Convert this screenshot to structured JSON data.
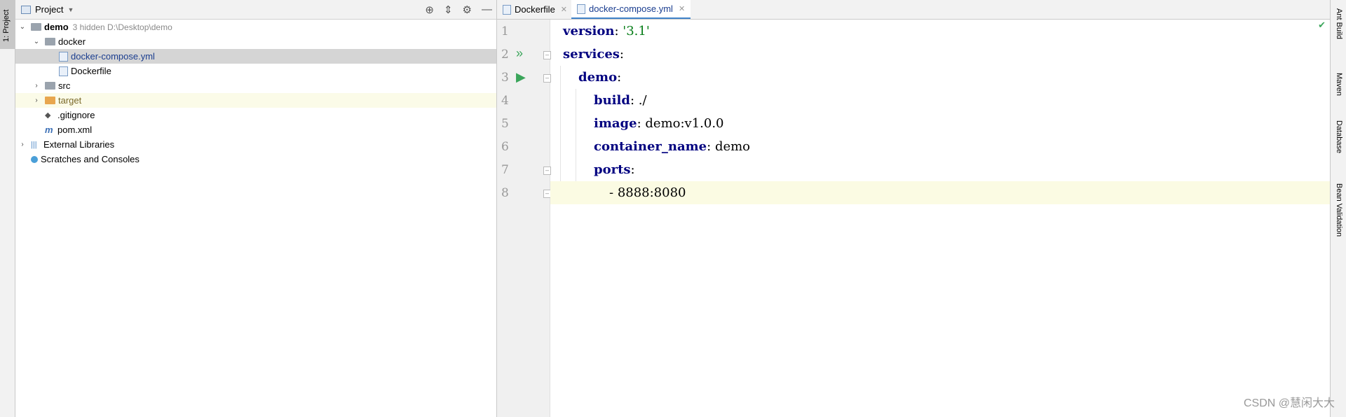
{
  "left_strip": {
    "tab_label": "1: Project"
  },
  "project": {
    "title": "Project",
    "tree": [
      {
        "label": "demo",
        "extra": "3 hidden  D:\\Desktop\\demo"
      },
      {
        "label": "docker"
      },
      {
        "label": "docker-compose.yml"
      },
      {
        "label": "Dockerfile"
      },
      {
        "label": "src"
      },
      {
        "label": "target"
      },
      {
        "label": ".gitignore"
      },
      {
        "label": "pom.xml"
      },
      {
        "label": "External Libraries"
      },
      {
        "label": "Scratches and Consoles"
      }
    ]
  },
  "editor": {
    "tabs": [
      {
        "label": "Dockerfile"
      },
      {
        "label": "docker-compose.yml"
      }
    ],
    "line_numbers": [
      "1",
      "2",
      "3",
      "4",
      "5",
      "6",
      "7",
      "8"
    ],
    "lines": [
      {
        "key": "version",
        "sep": ": ",
        "value": "'3.1'"
      },
      {
        "key": "services",
        "sep": ":",
        "value": ""
      },
      {
        "key": "demo",
        "sep": ":",
        "value": ""
      },
      {
        "key": "build",
        "sep": ": ",
        "value": "./"
      },
      {
        "key": "image",
        "sep": ": ",
        "value": "demo:v1.0.0"
      },
      {
        "key": "container_name",
        "sep": ": ",
        "value": "demo"
      },
      {
        "key": "ports",
        "sep": ":",
        "value": ""
      },
      {
        "key": "",
        "sep": "- ",
        "value": "8888:8080"
      }
    ]
  },
  "right_strip": {
    "tabs": [
      "Ant Build",
      "Maven",
      "Database",
      "Bean Validation"
    ]
  },
  "watermark": "CSDN @慧闲大大"
}
